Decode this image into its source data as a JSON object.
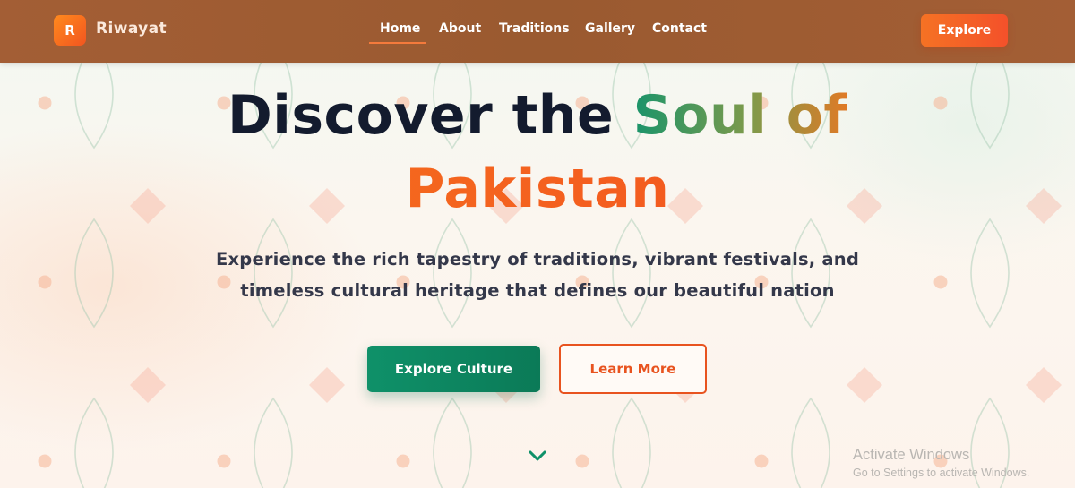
{
  "brand": {
    "logo_letter": "R",
    "name": "Riwayat",
    "accent": "#f36b22"
  },
  "nav": {
    "links": [
      "Home",
      "About",
      "Traditions",
      "Gallery",
      "Contact"
    ],
    "active": "Home",
    "cta_label": "Explore"
  },
  "hero": {
    "title_part1": "Discover the ",
    "title_highlight": "Soul of",
    "title_line2": "Pakistan",
    "subtitle_line1": "Experience the rich tapestry of traditions, vibrant festivals, and",
    "subtitle_line2": "timeless cultural heritage that defines our beautiful nation",
    "primary_button": "Explore Culture",
    "secondary_button": "Learn More",
    "scroll_icon": "chevron-down-icon"
  },
  "colors": {
    "nav_bg": "#9c5b32",
    "primary_green": "#0f9169",
    "orange": "#f36b22",
    "title_dark": "#131b2e"
  },
  "watermark": {
    "line1": "Activate Windows",
    "line2": "Go to Settings to activate Windows."
  }
}
